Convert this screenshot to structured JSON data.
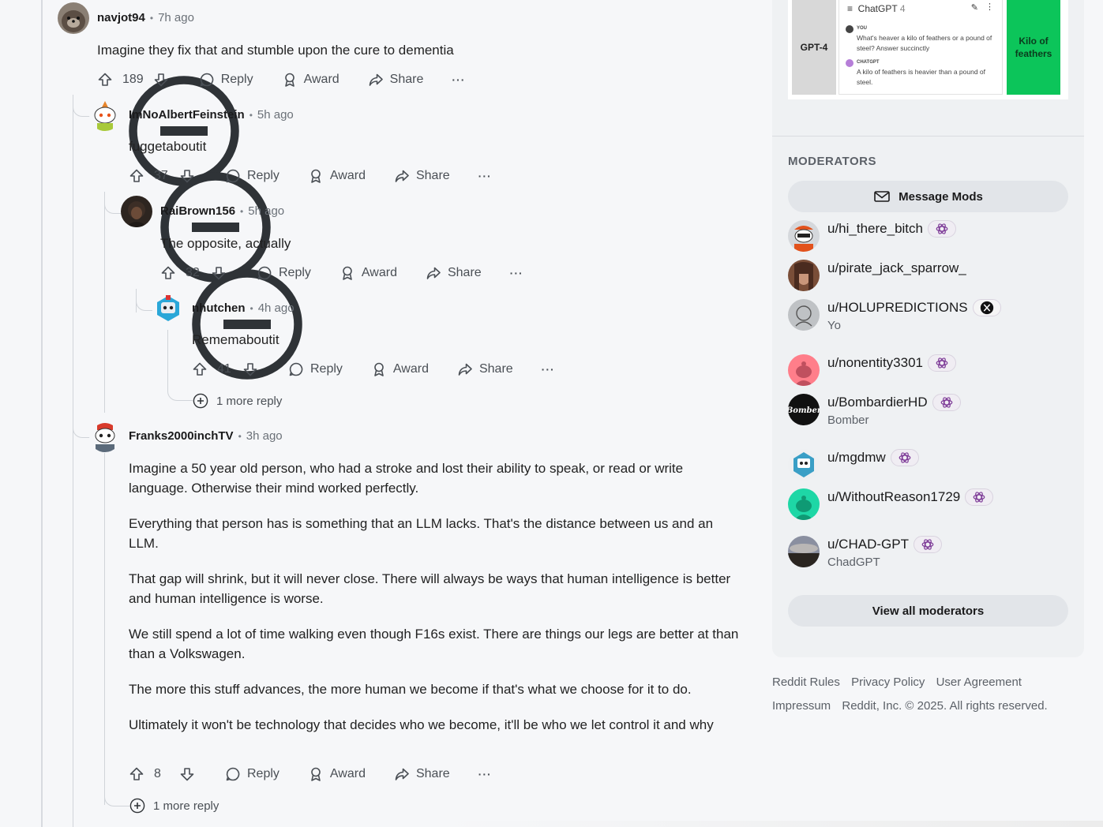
{
  "comments": [
    {
      "user": "navjot94",
      "time": "7h ago",
      "body": [
        "Imagine they fix that and stumble upon the cure to dementia"
      ],
      "votes": "189"
    },
    {
      "user": "ImNoAlbertFeinstein",
      "time": "5h ago",
      "body": [
        "fuggetaboutit"
      ],
      "votes": "37"
    },
    {
      "user": "RaiBrown156",
      "time": "5h ago",
      "body": [
        "The opposite, actually"
      ],
      "votes": "32"
    },
    {
      "user": "nhutchen",
      "time": "4h ago",
      "body": [
        "Rememaboutit"
      ],
      "votes": "41"
    },
    {
      "user": "Franks2000inchTV",
      "time": "3h ago",
      "body": [
        "Imagine a 50 year old person, who had a stroke and lost their ability to speak, or read or write language. Otherwise their mind worked perfectly.",
        "Everything that person has is something that an LLM lacks. That's the distance between us and an LLM.",
        "That gap will shrink, but it will never close. There will always be ways that human intelligence is better and human intelligence is worse.",
        "We still spend a lot of time walking even though F16s exist. There are things our legs are better at than than a Volkswagen.",
        "The more this stuff advances, the more human we become if that's what we choose for it to do.",
        "Ultimately it won't be technology that decides who we become, it'll be who we let control it and why"
      ],
      "votes": "8"
    }
  ],
  "actions": {
    "reply": "Reply",
    "award": "Award",
    "share": "Share",
    "more": "···"
  },
  "more_replies": [
    "1 more reply",
    "1 more reply"
  ],
  "promo": {
    "left_label": "GPT-4",
    "chat_title": "ChatGPT",
    "chat_version": "4",
    "you_label": "YOU",
    "question": "What's heaver a kilo of feathers or a pound of steel? Answer succinctly",
    "bot_label": "CHATGPT",
    "answer": "A kilo of feathers is heavier than a pound of steel.",
    "right_label": "Kilo of feathers"
  },
  "sidebar": {
    "moderators_title": "MODERATORS",
    "message_mods": "Message Mods",
    "view_all": "View all moderators",
    "moderators": [
      {
        "name": "u/hi_there_bitch",
        "flair": "openai-icon",
        "sub": ""
      },
      {
        "name": "u/pirate_jack_sparrow_",
        "flair": "",
        "sub": ""
      },
      {
        "name": "u/HOLUPREDICTIONS",
        "flair": "x-icon",
        "sub": "Yo"
      },
      {
        "name": "u/nonentity3301",
        "flair": "openai-icon",
        "sub": ""
      },
      {
        "name": "u/BombardierHD",
        "flair": "openai-icon",
        "sub": "Bomber"
      },
      {
        "name": "u/mgdmw",
        "flair": "openai-icon",
        "sub": ""
      },
      {
        "name": "u/WithoutReason1729",
        "flair": "openai-icon",
        "sub": ""
      },
      {
        "name": "u/CHAD-GPT",
        "flair": "openai-icon",
        "sub": "ChadGPT"
      }
    ],
    "bomber_avatar_text": "Bomber"
  },
  "footer": {
    "links_row1": [
      "Reddit Rules",
      "Privacy Policy",
      "User Agreement"
    ],
    "impressum": "Impressum",
    "copyright": "Reddit, Inc. © 2025. All rights reserved."
  },
  "colors": {
    "accent_green": "#0cc55a",
    "thread_line": "#d0d4d9",
    "sidebar_bg": "#eff1f3"
  }
}
